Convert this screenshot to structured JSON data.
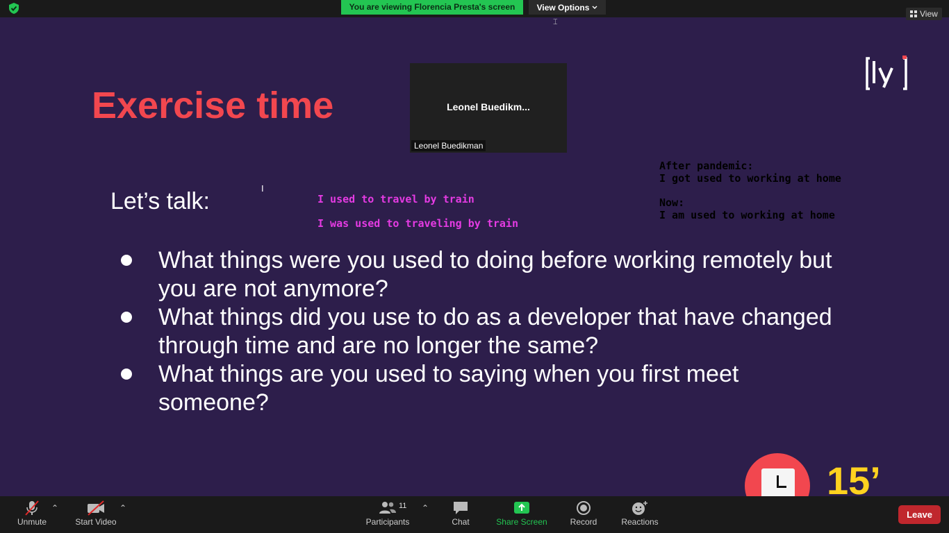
{
  "topbar": {
    "banner": "You are viewing Florencia Presta's screen",
    "view_options": "View Options",
    "view_button": "View",
    "shield_icon": "shield-check-icon",
    "accent_green": "#23c552"
  },
  "slide": {
    "title": "Exercise time",
    "logo_text": "[ly]",
    "lets_talk": "Let’s talk:",
    "pink_notes": [
      "I used to travel by train",
      "I was used to traveling by train"
    ],
    "black_notes": {
      "label1": "After pandemic:",
      "line1": "I got used to working at home",
      "label2": "Now:",
      "line2": "I am used to working at home"
    },
    "bullets": [
      "What things were you used to doing before working remotely but you are not anymore?",
      "What things did you use to do as a developer that have changed through time and are no longer the same?",
      "What things are you used to saying when you first meet someone?"
    ],
    "timer": "15’",
    "title_color": "#f2474f",
    "timer_color": "#ffd21f",
    "background_color": "#2d1e4b"
  },
  "video": {
    "display_name": "Leonel  Buedikm...",
    "label": "Leonel Buedikman"
  },
  "toolbar": {
    "unmute": "Unmute",
    "start_video": "Start Video",
    "participants": "Participants",
    "participant_count": "11",
    "chat": "Chat",
    "share_screen": "Share Screen",
    "record": "Record",
    "reactions": "Reactions",
    "leave": "Leave"
  }
}
